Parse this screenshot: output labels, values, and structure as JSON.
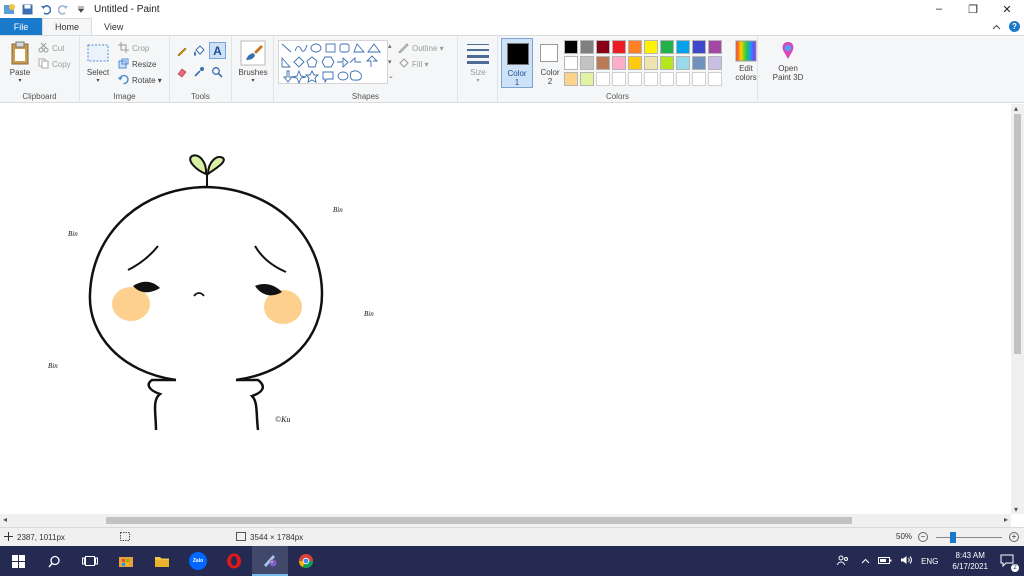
{
  "window": {
    "title": "Untitled - Paint",
    "controls": [
      "–",
      "❐",
      "✕"
    ]
  },
  "tabs": [
    {
      "label": "File"
    },
    {
      "label": "Home"
    },
    {
      "label": "View"
    }
  ],
  "ribbon": {
    "clipboard": {
      "group": "Clipboard",
      "paste": "Paste",
      "cut": "Cut",
      "copy": "Copy"
    },
    "image": {
      "group": "Image",
      "select": "Select",
      "crop": "Crop",
      "resize": "Resize",
      "rotate": "Rotate ▾"
    },
    "tools": {
      "group": "Tools"
    },
    "brushes": {
      "label": "Brushes"
    },
    "shapes": {
      "group": "Shapes",
      "outline": "Outline ▾",
      "fill": "Fill ▾"
    },
    "size": {
      "label": "Size"
    },
    "colors": {
      "group": "Colors",
      "color1_label_a": "Color",
      "color1_label_b": "1",
      "color2_label_a": "Color",
      "color2_label_b": "2",
      "color1_value": "#000000",
      "color2_value": "#ffffff",
      "palette_row1": [
        "#000000",
        "#7f7f7f",
        "#880015",
        "#ed1c24",
        "#ff7f27",
        "#fff200",
        "#22b14c",
        "#00a2e8",
        "#3f48cc",
        "#a349a4"
      ],
      "palette_row2": [
        "#ffffff",
        "#c3c3c3",
        "#b97a57",
        "#ffaec9",
        "#ffc90e",
        "#efe4b0",
        "#b5e61d",
        "#99d9ea",
        "#7092be",
        "#c8bfe7"
      ],
      "palette_row3": [
        "#fbd38a",
        "#e3f2a0",
        "",
        "",
        "",
        "",
        "",
        "",
        "",
        ""
      ],
      "edit_a": "Edit",
      "edit_b": "colors"
    },
    "paint3d": {
      "label_a": "Open",
      "label_b": "Paint 3D"
    }
  },
  "canvas": {
    "signatures": [
      "Bin",
      "Bin",
      "Bin",
      "Bin",
      "©Ku"
    ],
    "colors": {
      "sprout": "#d9efa3",
      "blush": "#fdd08e",
      "ink": "#111111"
    }
  },
  "status": {
    "cursor_pos": "2387, 1011px",
    "canvas_size": "3544 × 1784px",
    "zoom": "50%"
  },
  "taskbar": {
    "lang": "ENG",
    "time": "8:43 AM",
    "date": "6/17/2021",
    "notif_count": "2",
    "zalo": "Zalo"
  }
}
